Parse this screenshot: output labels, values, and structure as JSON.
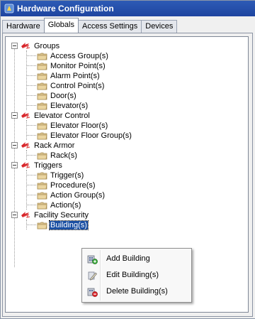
{
  "window": {
    "title": "Hardware Configuration"
  },
  "tabs": [
    {
      "label": "Hardware",
      "active": false
    },
    {
      "label": "Globals",
      "active": true
    },
    {
      "label": "Access Settings",
      "active": false
    },
    {
      "label": "Devices",
      "active": false
    }
  ],
  "tree": {
    "groups": {
      "label": "Groups",
      "children": [
        "Access Group(s)",
        "Monitor Point(s)",
        "Alarm Point(s)",
        "Control Point(s)",
        "Door(s)",
        "Elevator(s)"
      ]
    },
    "elevator_control": {
      "label": "Elevator Control",
      "children": [
        "Elevator Floor(s)",
        "Elevator Floor Group(s)"
      ]
    },
    "rack_armor": {
      "label": "Rack Armor",
      "children": [
        "Rack(s)"
      ]
    },
    "triggers": {
      "label": "Triggers",
      "children": [
        "Trigger(s)",
        "Procedure(s)",
        "Action Group(s)",
        "Action(s)"
      ]
    },
    "facility_security": {
      "label": "Facility Security",
      "children": [
        "Building(s)"
      ],
      "selected_child": "Building(s)"
    }
  },
  "context_menu": {
    "items": [
      {
        "label": "Add Building",
        "icon": "add-building-icon"
      },
      {
        "label": "Edit Building(s)",
        "icon": "edit-building-icon"
      },
      {
        "label": "Delete Building(s)",
        "icon": "delete-building-icon"
      }
    ]
  },
  "colors": {
    "titlebar": "#1e44a0",
    "selection": "#1a4fa3",
    "root_icon_red": "#d8262b",
    "folder_tan": "#d8c08a"
  }
}
